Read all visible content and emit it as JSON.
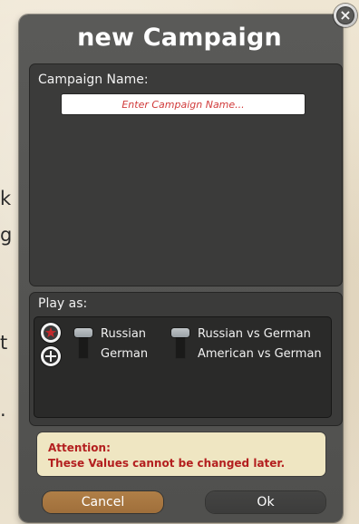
{
  "background": {
    "fragments": [
      {
        "id": "bg-fragment-1",
        "text": "k"
      },
      {
        "id": "bg-fragment-2",
        "text": "g"
      },
      {
        "id": "bg-fragment-3",
        "text": "t"
      },
      {
        "id": "bg-fragment-4",
        "text": "."
      }
    ]
  },
  "dialog": {
    "title": "new Campaign",
    "close_icon": "close-icon",
    "campaign_name": {
      "label": "Campaign Name:",
      "value": "",
      "placeholder": "Enter Campaign Name..."
    },
    "play_as": {
      "label": "Play as:",
      "options": {
        "left": [
          {
            "label": "Russian",
            "icon": "soviet-star-icon"
          },
          {
            "label": "German",
            "icon": "iron-cross-icon"
          }
        ],
        "right": [
          {
            "label": "Russian vs German"
          },
          {
            "label": "American vs German"
          }
        ]
      },
      "toggles": [
        {
          "name": "faction-toggle",
          "selected_index": 0
        },
        {
          "name": "matchup-toggle",
          "selected_index": 0
        }
      ]
    },
    "attention": {
      "title": "Attention:",
      "text": "These Values cannot be changed later."
    },
    "buttons": {
      "cancel": "Cancel",
      "ok": "Ok"
    },
    "colors": {
      "dialog": "#555553",
      "panel": "#3b3b3a",
      "accent_cancel": "#a9743f",
      "attention_bg": "#efe6c2",
      "attention_text": "#b31f1f",
      "placeholder": "#d13a3a"
    }
  }
}
